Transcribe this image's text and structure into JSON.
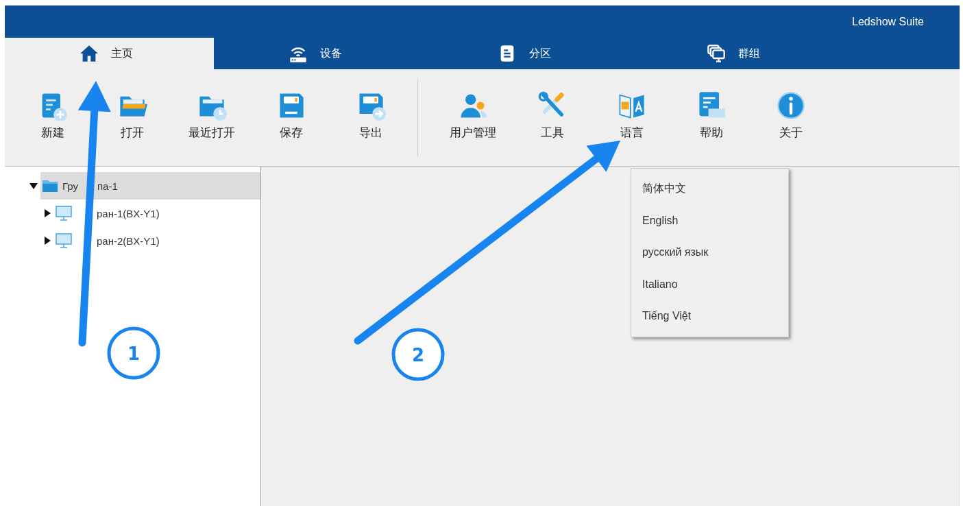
{
  "window": {
    "title": "Ledshow Suite"
  },
  "tabs": [
    {
      "label": "主页",
      "kind": "home",
      "selected": true
    },
    {
      "label": "设备",
      "kind": "device",
      "selected": false
    },
    {
      "label": "分区",
      "kind": "area",
      "selected": false
    },
    {
      "label": "群组",
      "kind": "group",
      "selected": false
    }
  ],
  "toolbar": {
    "groups": [
      [
        {
          "label": "新建",
          "kind": "new"
        },
        {
          "label": "打开",
          "kind": "open"
        },
        {
          "label": "最近打开",
          "kind": "recent"
        },
        {
          "label": "保存",
          "kind": "save"
        },
        {
          "label": "导出",
          "kind": "export"
        }
      ],
      [
        {
          "label": "用户管理",
          "kind": "users"
        },
        {
          "label": "工具",
          "kind": "tools"
        },
        {
          "label": "语言",
          "kind": "language"
        },
        {
          "label": "帮助",
          "kind": "help"
        },
        {
          "label": "关于",
          "kind": "about"
        }
      ]
    ]
  },
  "tree": [
    {
      "label_parts": [
        "Гру",
        "па-1"
      ],
      "kind": "folder",
      "expanded": true,
      "selected": true,
      "children": [
        {
          "label_parts": [
            "ран-1(BX-Y1)"
          ],
          "covered_start": true,
          "kind": "screen",
          "expanded": false,
          "selected": false
        },
        {
          "label_parts": [
            "ран-2(BX-Y1)"
          ],
          "covered_start": true,
          "kind": "screen",
          "expanded": false,
          "selected": false
        }
      ]
    }
  ],
  "language_menu": {
    "items": [
      {
        "label": "简体中文"
      },
      {
        "label": "English"
      },
      {
        "label": "русский язык"
      },
      {
        "label": "Italiano"
      },
      {
        "label": "Tiếng Việt"
      }
    ]
  },
  "annotations": [
    {
      "number": "1"
    },
    {
      "number": "2"
    }
  ]
}
